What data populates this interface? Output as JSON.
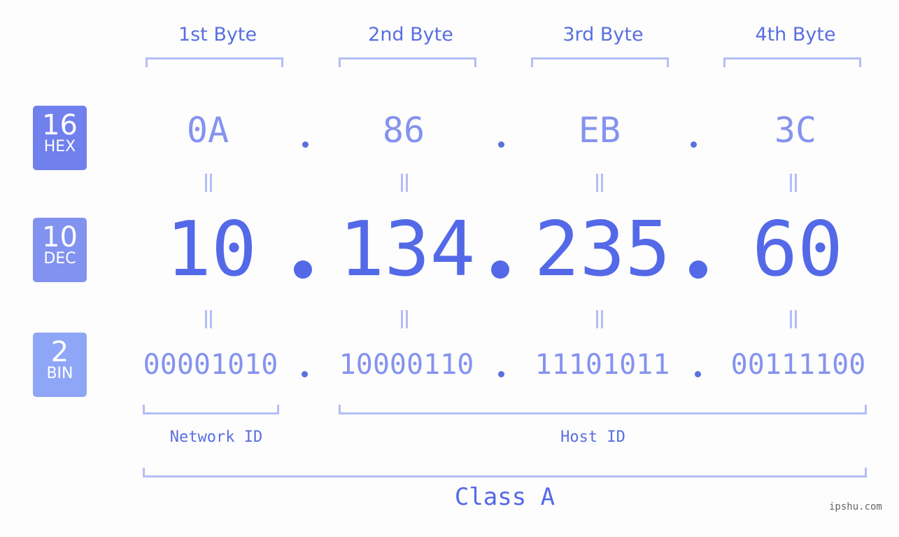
{
  "badges": [
    {
      "num": "16",
      "label": "HEX",
      "color": "#7080ec"
    },
    {
      "num": "10",
      "label": "DEC",
      "color": "#8292f0"
    },
    {
      "num": "2",
      "label": "BIN",
      "color": "#8fa6f6"
    }
  ],
  "byte_headers": [
    "1st Byte",
    "2nd Byte",
    "3rd Byte",
    "4th Byte"
  ],
  "hex": [
    "0A",
    "86",
    "EB",
    "3C"
  ],
  "dec": [
    "10",
    "134",
    "235",
    "60"
  ],
  "bin": [
    "00001010",
    "10000110",
    "11101011",
    "00111100"
  ],
  "separator": ".",
  "network_label": "Network ID",
  "host_label": "Host ID",
  "class_label": "Class A",
  "watermark": "ipshu.com",
  "colors": {
    "accent": "#5469e8",
    "light": "#8593ef",
    "bracket": "#b4bdf6"
  }
}
